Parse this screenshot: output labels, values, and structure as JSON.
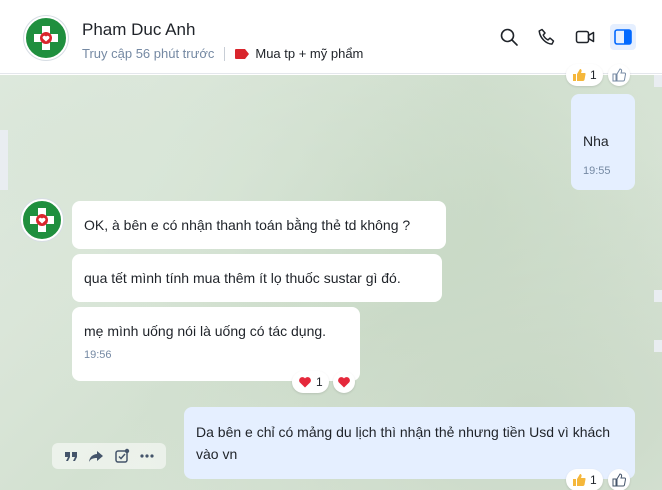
{
  "header": {
    "contact_name": "Pham Duc Anh",
    "last_seen": "Truy cập 56 phút trước",
    "label": "Mua tp + mỹ phẩm",
    "label_color": "#d9252c",
    "avatar_icon": "medical-cross-logo-icon",
    "tools": [
      "search-icon",
      "phone-icon",
      "video-call-icon",
      "sidebar-toggle-icon"
    ]
  },
  "messages": {
    "outgoing_1": {
      "text": "Nha",
      "time": "19:55"
    },
    "incoming": [
      {
        "text": "OK, à bên e có nhận thanh toán bằng thẻ td không ?"
      },
      {
        "text": "qua tết mình tính mua thêm ít lọ thuốc sustar gì đó."
      },
      {
        "text": "mẹ mình uống nói là uống có tác dụng.",
        "time": "19:56"
      }
    ],
    "outgoing_2": {
      "text": "Da bên e chỉ có mảng du lịch thì nhận thẻ nhưng tiền Usd vì khách vào vn"
    }
  },
  "reactions": {
    "top_count": "1",
    "incoming_count": "1",
    "incoming_emoji": "heart-icon",
    "bottom_count": "1",
    "bottom_emoji": "thumbs-up-icon"
  },
  "hover_tools": [
    "quote-icon",
    "forward-icon",
    "task-icon",
    "more-icon"
  ],
  "colors": {
    "accent": "#0068ff",
    "bubble_mine": "#e5efff",
    "bubble_theirs": "#ffffff"
  }
}
